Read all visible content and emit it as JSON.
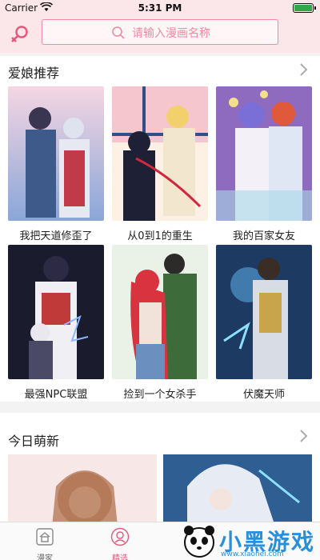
{
  "status_bar": {
    "carrier": "Carrier",
    "time": "5:31 PM"
  },
  "header": {
    "search_placeholder": "请输入漫画名称"
  },
  "sections": [
    {
      "title": "爱娘推荐",
      "items": [
        "我把天道修歪了",
        "从0到1的重生",
        "我的百家女友",
        "最强NPC联盟",
        "捡到一个女杀手",
        "伏魔天师"
      ]
    },
    {
      "title": "今日萌新",
      "items": [
        "",
        ""
      ]
    }
  ],
  "tabbar": {
    "tabs": [
      {
        "label": "漫家"
      },
      {
        "label": "精选"
      }
    ]
  },
  "watermark": {
    "title": "小黑游戏",
    "url": "www.xiaohei.com"
  },
  "colors": {
    "accent": "#f08aa0",
    "header_bg": "#fbe6ea",
    "active_tab": "#e8557a"
  }
}
